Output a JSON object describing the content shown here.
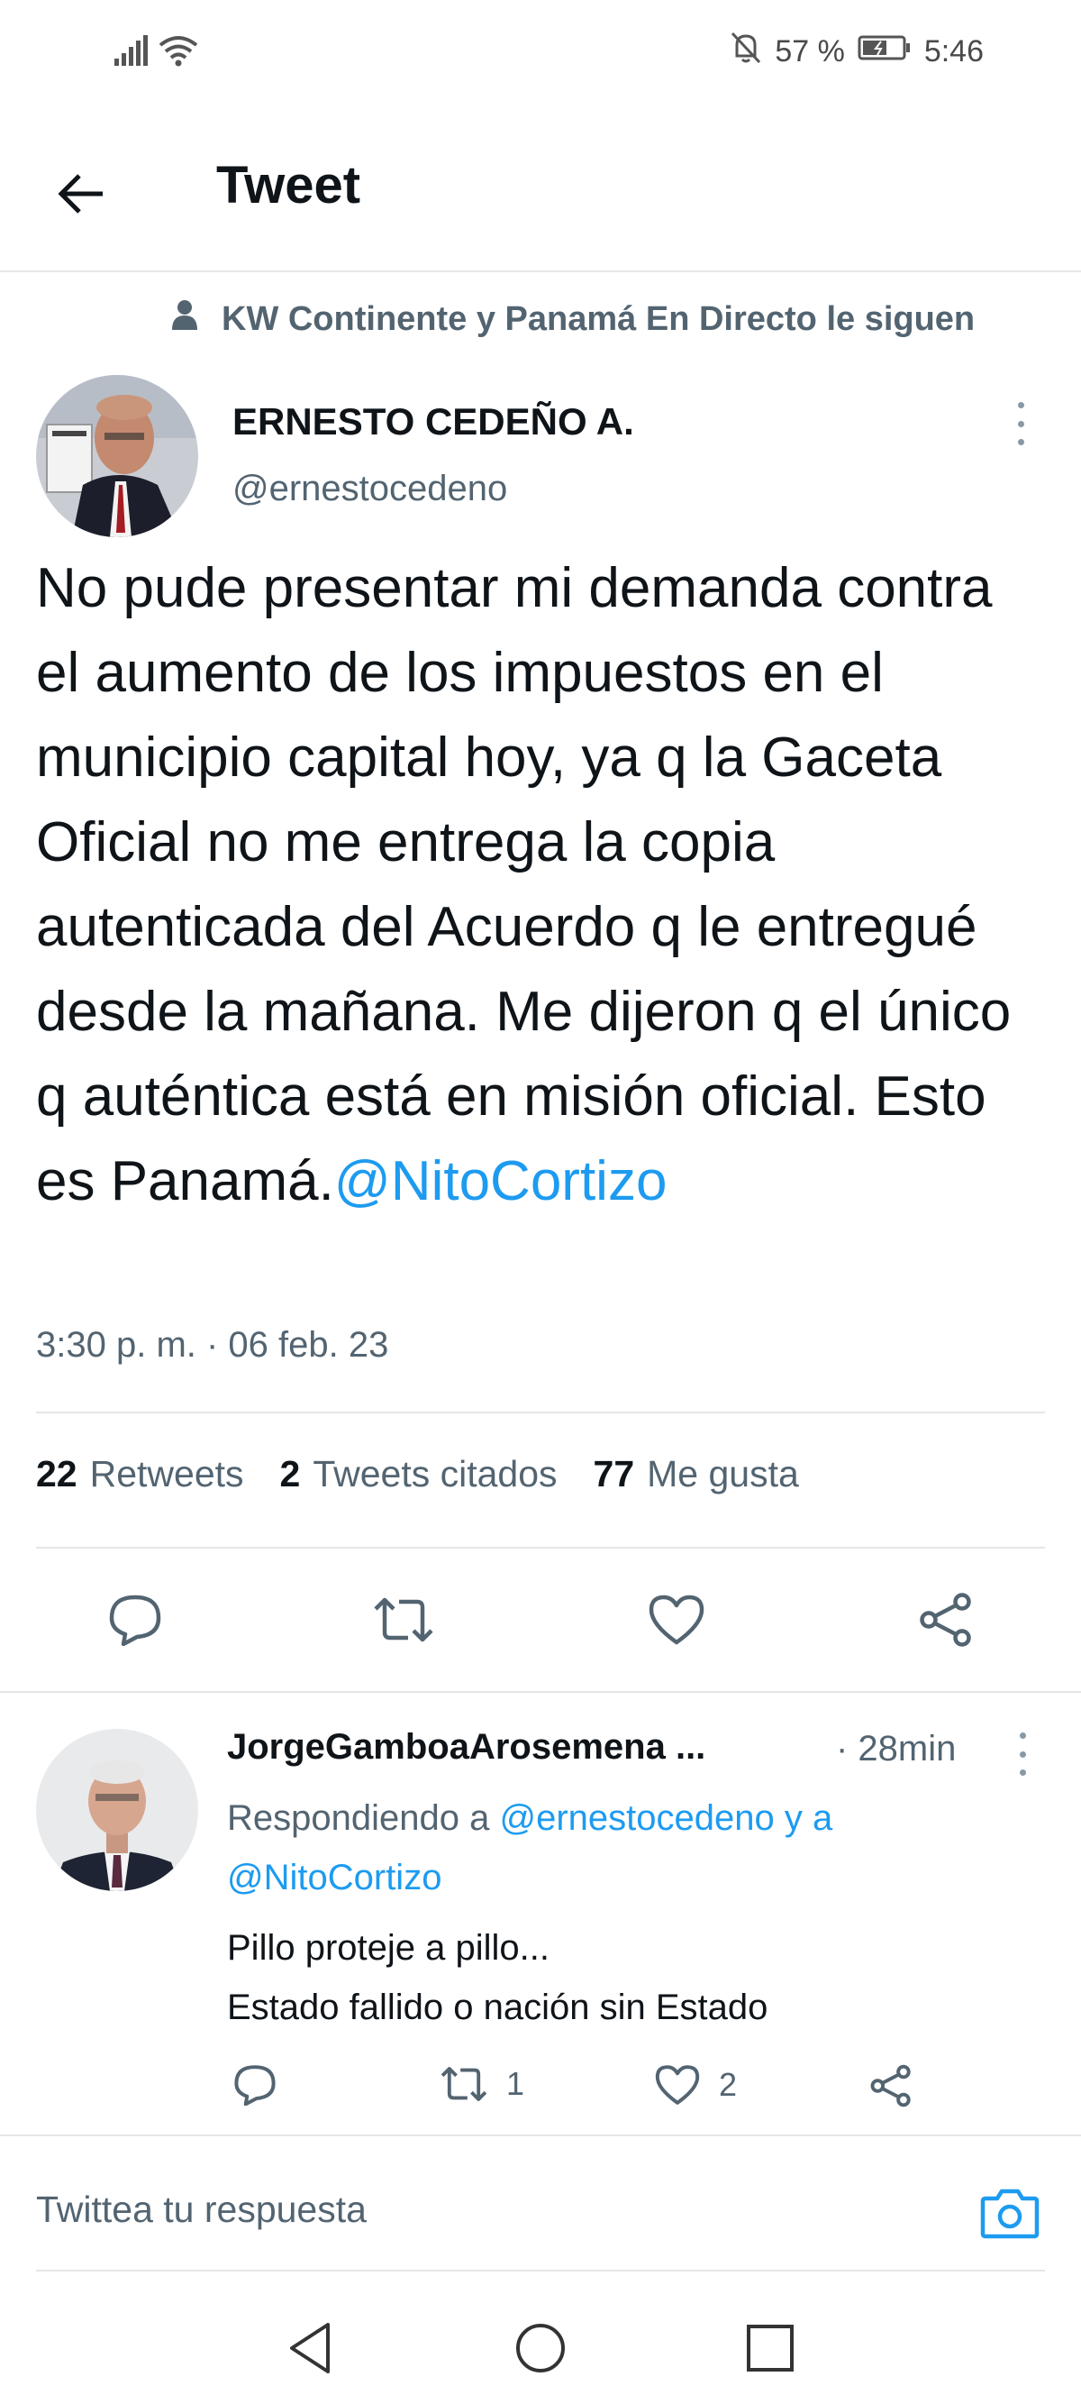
{
  "status_bar": {
    "battery_percent": "57 %",
    "time": "5:46",
    "icons": [
      "signal-icon",
      "wifi-icon",
      "mute-icon",
      "battery-icon"
    ]
  },
  "header": {
    "title": "Tweet",
    "back_icon": "back-arrow-icon"
  },
  "social_context": {
    "icon": "person-icon",
    "text": "KW Continente y Panamá En Directo le siguen"
  },
  "tweet": {
    "author_name": "ERNESTO CEDEÑO A.",
    "author_handle": "@ernestocedeno",
    "text_main": "No pude presentar mi demanda contra el aumento de los impuestos en el municipio capital hoy, ya q la Gaceta Oficial no me entrega la copia autenticada del Acuerdo q le entregué desde la mañana. Me dijeron q el único q auténtica está en misión oficial. Esto es Panamá.",
    "mention": "@NitoCortizo",
    "timestamp": "3:30 p. m. · 06 feb. 23"
  },
  "stats": {
    "retweets_count": "22",
    "retweets_label": "Retweets",
    "quotes_count": "2",
    "quotes_label": "Tweets citados",
    "likes_count": "77",
    "likes_label": "Me gusta"
  },
  "actions": [
    "reply-icon",
    "retweet-icon",
    "like-icon",
    "share-icon"
  ],
  "reply": {
    "author_name": "JorgeGamboaArosemena ...",
    "time": "· 28min",
    "replying_prefix": "Respondiendo a",
    "replying_handle1": "@ernestocedeno",
    "replying_and": "y a",
    "replying_handle2": "@NitoCortizo",
    "line1": "Pillo proteje a pillo...",
    "line2": "Estado fallido o nación sin Estado",
    "retweet_count": "1",
    "like_count": "2"
  },
  "composer": {
    "placeholder": "Twittea tu respuesta",
    "camera_icon": "camera-icon"
  },
  "nav_bar": [
    "nav-back-icon",
    "nav-home-icon",
    "nav-recents-icon"
  ],
  "colors": {
    "accent": "#1d9bf0",
    "text": "#0f1419",
    "muted": "#536471",
    "divider": "#e6e6e6"
  }
}
